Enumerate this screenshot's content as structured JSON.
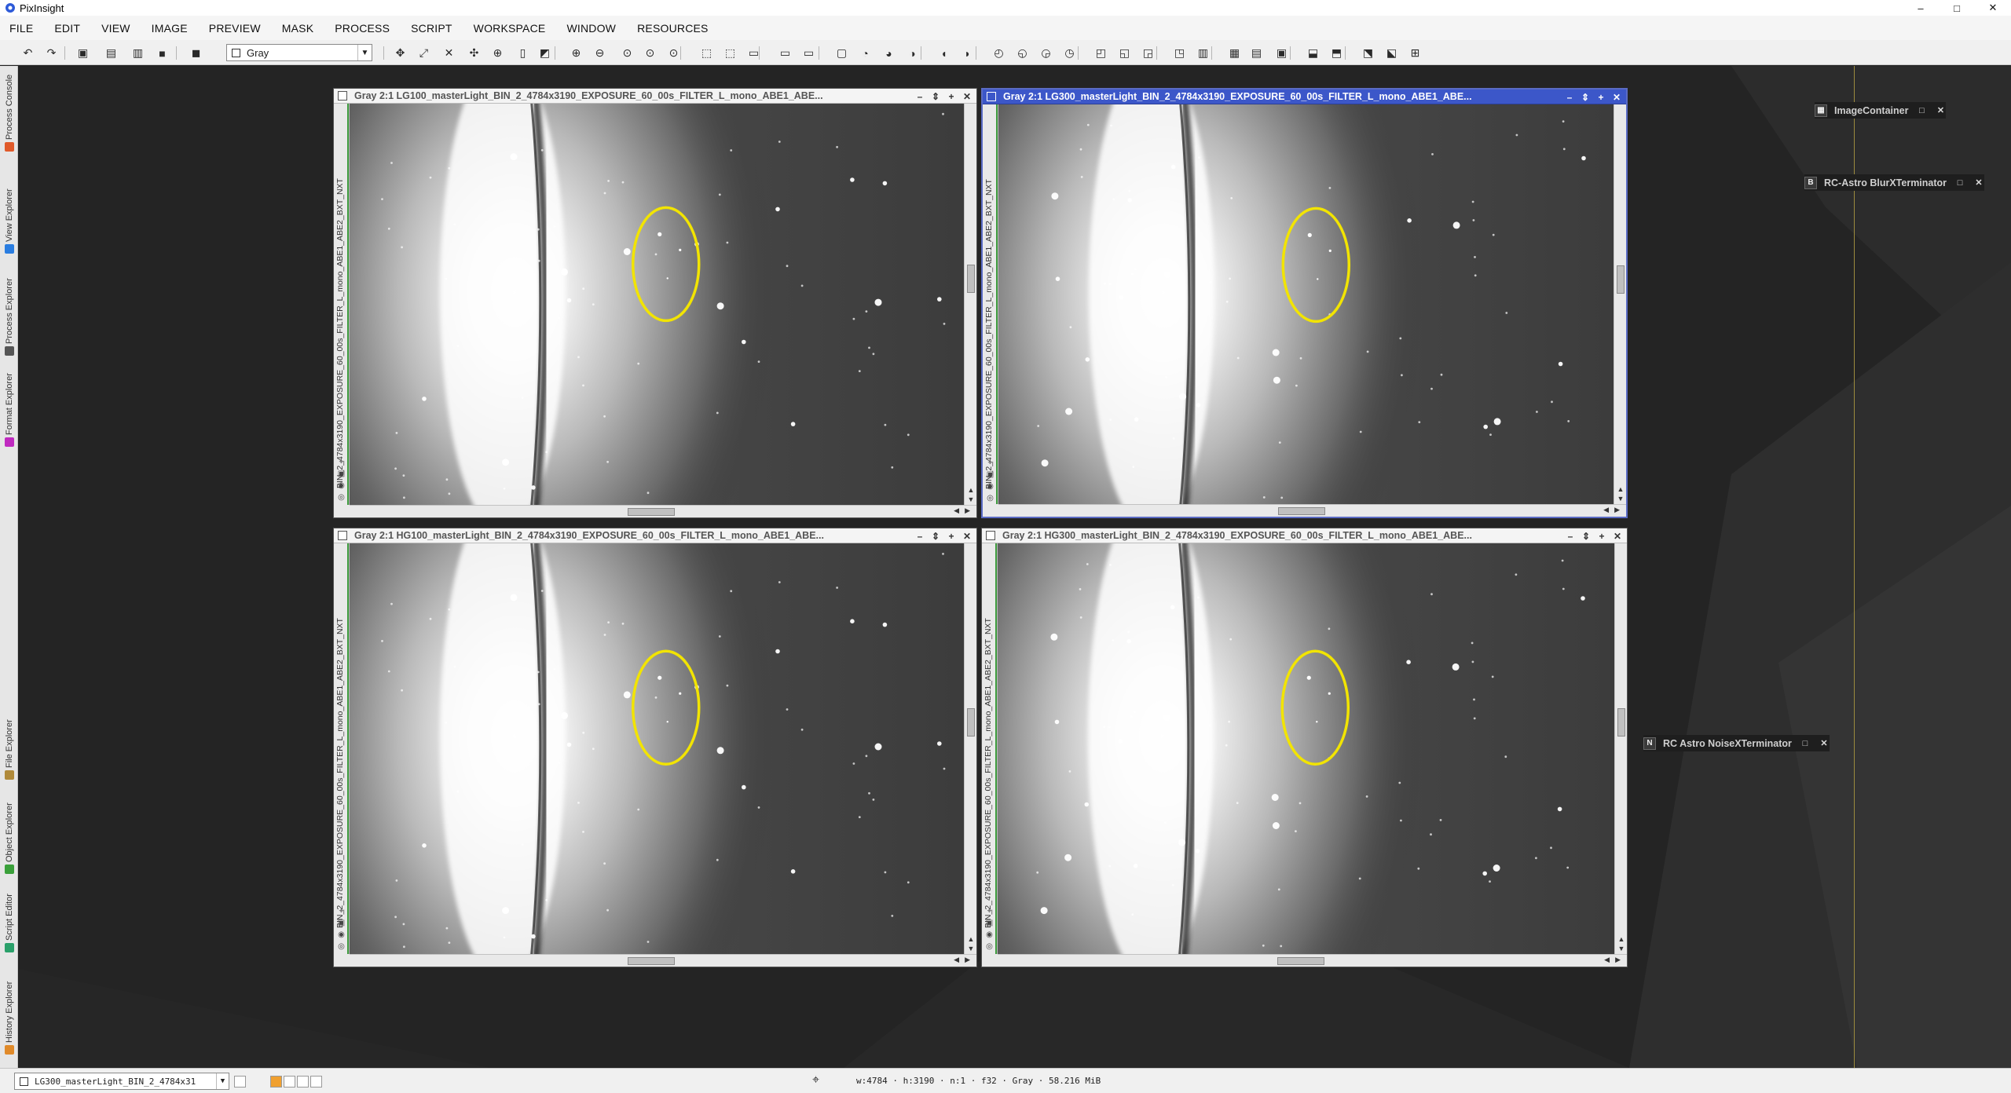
{
  "app": {
    "title": "PixInsight",
    "window_controls": [
      "–",
      "□",
      "✕"
    ]
  },
  "menubar": {
    "items": [
      "FILE",
      "EDIT",
      "VIEW",
      "IMAGE",
      "PREVIEW",
      "MASK",
      "PROCESS",
      "SCRIPT",
      "WORKSPACE",
      "WINDOW",
      "RESOURCES"
    ]
  },
  "toolbar": {
    "mode_select": "Gray",
    "icons": [
      "undo-icon",
      "redo-icon",
      "process-icon",
      "new-image-icon",
      "open-icon",
      "save-icon",
      "color-icon",
      "pan-icon",
      "zoom-fit-icon",
      "zoom-all-icon",
      "move-icon",
      "rotate-icon",
      "readout-icon",
      "mask-icon",
      "zoom-in-icon",
      "zoom-out-icon",
      "zoom-1-icon",
      "zoom-2-icon",
      "zoom-3-icon",
      "preview-icon",
      "preview2-icon",
      "preview3-icon",
      "stf-icon",
      "histogram-icon",
      "curves-icon",
      "curves2-icon",
      "curves3-icon",
      "fft-icon",
      "fft2-icon",
      "abe-icon",
      "abe2-icon",
      "dbe-icon",
      "dbe2-icon",
      "dbe3-icon",
      "stretch-icon",
      "stretch2-icon",
      "stretch3-icon",
      "layout-icon",
      "layout2-icon",
      "layout3-icon",
      "monitor-icon",
      "monitor2-icon",
      "export-icon",
      "export2-icon",
      "export3-icon",
      "settings-icon",
      "settings2-icon"
    ]
  },
  "side_panel": {
    "tabs": [
      {
        "label": "Process Console",
        "icon_color": "#e05a2a"
      },
      {
        "label": "View Explorer",
        "icon_color": "#2a7de0"
      },
      {
        "label": "Process Explorer",
        "icon_color": "#555555"
      },
      {
        "label": "Format Explorer",
        "icon_color": "#c02ac0"
      },
      {
        "label": "File Explorer",
        "icon_color": "#b08a3a"
      },
      {
        "label": "Object Explorer",
        "icon_color": "#3aa03a"
      },
      {
        "label": "Script Editor",
        "icon_color": "#2aa06a"
      },
      {
        "label": "History Explorer",
        "icon_color": "#e08a2a"
      }
    ]
  },
  "image_windows": [
    {
      "id": "LG100",
      "title": "Gray 2:1 LG100_masterLight_BIN_2_4784x3190_EXPOSURE_60_00s_FILTER_L_mono_ABE1_ABE...",
      "side_label": "BIN_2_4784x3190_EXPOSURE_60_00s_FILTER_L_mono_ABE1_ABE2_BXT_NXT",
      "active": false,
      "v_thumb": 0.43,
      "h_thumb": 0.48
    },
    {
      "id": "LG300",
      "title": "Gray 2:1 LG300_masterLight_BIN_2_4784x3190_EXPOSURE_60_00s_FILTER_L_mono_ABE1_ABE...",
      "side_label": "BIN_2_4784x3190_EXPOSURE_60_00s_FILTER_L_mono_ABE1_ABE2_BXT_NXT",
      "active": true,
      "v_thumb": 0.43,
      "h_thumb": 0.48
    },
    {
      "id": "HG100",
      "title": "Gray 2:1 HG100_masterLight_BIN_2_4784x3190_EXPOSURE_60_00s_FILTER_L_mono_ABE1_ABE...",
      "side_label": "BIN_2_4784x3190_EXPOSURE_60_00s_FILTER_L_mono_ABE1_ABE2_BXT_NXT",
      "active": false,
      "v_thumb": 0.43,
      "h_thumb": 0.48
    },
    {
      "id": "HG300",
      "title": "Gray 2:1 HG300_masterLight_BIN_2_4784x3190_EXPOSURE_60_00s_FILTER_L_mono_ABE1_ABE...",
      "side_label": "BIN_2_4784x3190_EXPOSURE_60_00s_FILTER_L_mono_ABE1_ABE2_BXT_NXT",
      "active": false,
      "v_thumb": 0.43,
      "h_thumb": 0.48
    }
  ],
  "image_window_buttons": [
    "–",
    "⇕",
    "+",
    "✕"
  ],
  "annotation_color": "#f2e400",
  "iconized_processes": [
    {
      "badge": "",
      "label": "ImageContainer"
    },
    {
      "badge": "B",
      "label": "RC-Astro BlurXTerminator"
    },
    {
      "badge": "N",
      "label": "RC Astro NoiseXTerminator"
    }
  ],
  "statusbar": {
    "current_view": "LG300_masterLight_BIN_2_4784x31",
    "image_info": "w:4784 · h:3190 · n:1 · f32 · Gray · 58.216 MiB"
  },
  "colors": {
    "active_title": "#3c57c9",
    "workspace_bg": "#242424",
    "marker_line": "#9c8b3e"
  }
}
